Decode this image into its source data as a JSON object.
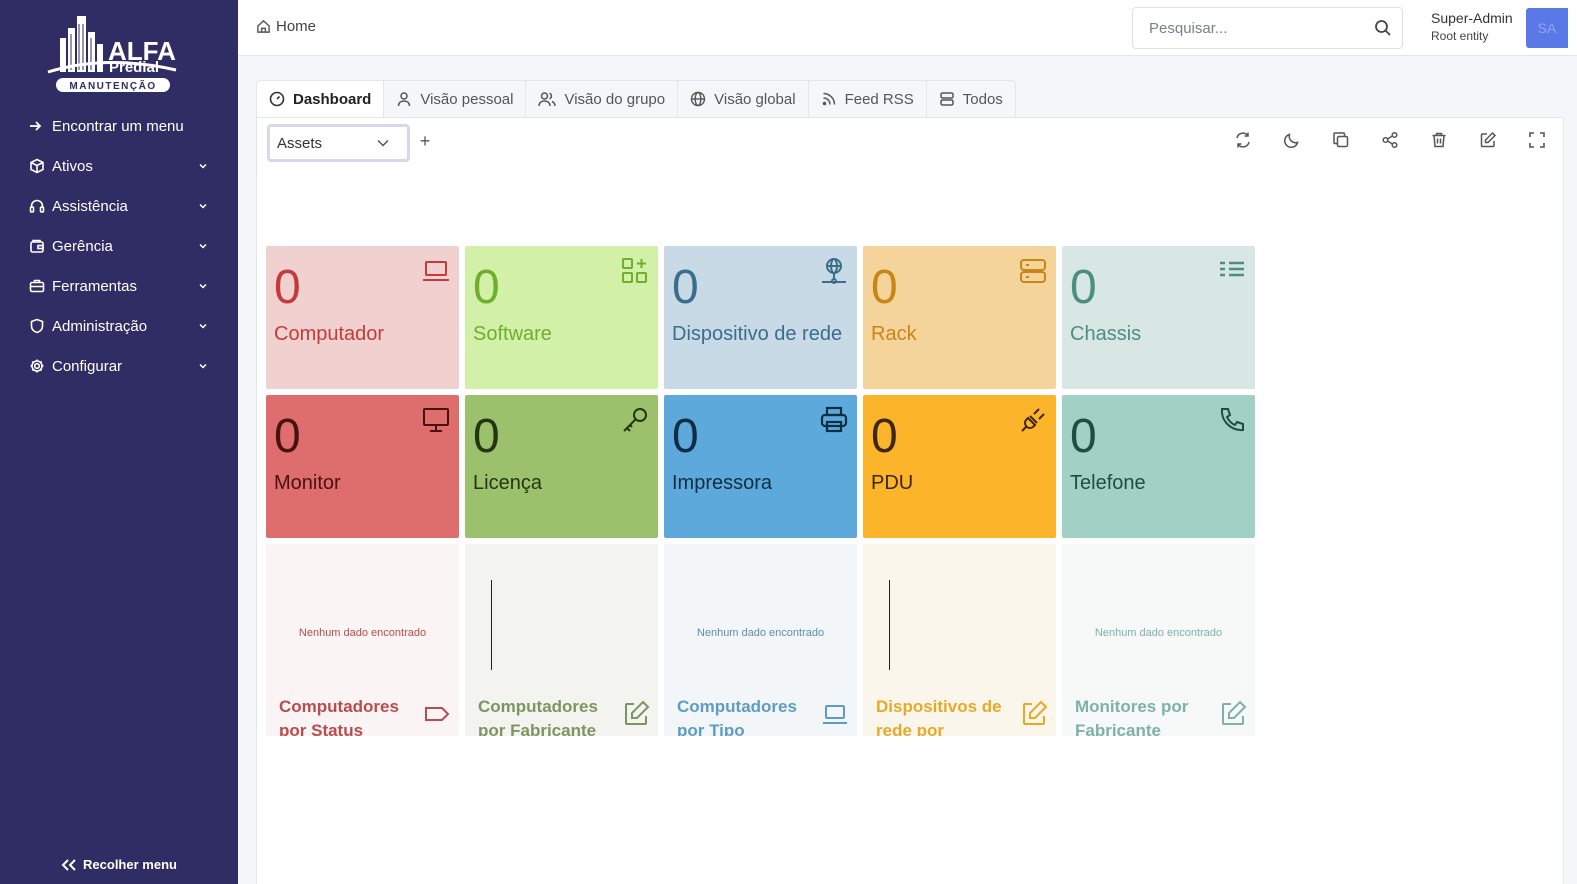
{
  "sidebar": {
    "logo": {
      "word1": "ALFA",
      "word2": "Predial",
      "word3": "MANUTENÇÃO"
    },
    "find_menu": "Encontrar um menu",
    "items": [
      {
        "label": "Ativos",
        "icon": "cube-icon"
      },
      {
        "label": "Assistência",
        "icon": "headset-icon"
      },
      {
        "label": "Gerência",
        "icon": "wallet-icon"
      },
      {
        "label": "Ferramentas",
        "icon": "briefcase-icon"
      },
      {
        "label": "Administração",
        "icon": "shield-icon"
      },
      {
        "label": "Configurar",
        "icon": "gear-icon"
      }
    ],
    "collapse": "Recolher menu"
  },
  "header": {
    "breadcrumb": "Home",
    "search_placeholder": "Pesquisar...",
    "user_name": "Super-Admin",
    "user_entity": "Root entity",
    "avatar_initials": "SA"
  },
  "tabs": [
    {
      "label": "Dashboard",
      "icon": "gauge-icon",
      "active": true
    },
    {
      "label": "Visão pessoal",
      "icon": "user-icon"
    },
    {
      "label": "Visão do grupo",
      "icon": "users-icon"
    },
    {
      "label": "Visão global",
      "icon": "globe-icon"
    },
    {
      "label": "Feed RSS",
      "icon": "rss-icon"
    },
    {
      "label": "Todos",
      "icon": "stack-icon"
    }
  ],
  "dashboard": {
    "selected": "Assets",
    "add": "+"
  },
  "cards": [
    {
      "value": "0",
      "label": "Computador",
      "icon": "laptop-icon",
      "bg": "#f1d0d0",
      "fg": "#c43b3b"
    },
    {
      "value": "0",
      "label": "Software",
      "icon": "apps-add-icon",
      "bg": "#d3f0a9",
      "fg": "#6fae2e"
    },
    {
      "value": "0",
      "label": "Dispositivo de rede",
      "icon": "network-icon",
      "bg": "#c8dae5",
      "fg": "#3b6d8c"
    },
    {
      "value": "0",
      "label": "Rack",
      "icon": "server-icon",
      "bg": "#f5d49c",
      "fg": "#c88617"
    },
    {
      "value": "0",
      "label": "Chassis",
      "icon": "list-icon",
      "bg": "#d8e7e4",
      "fg": "#4c8f82"
    },
    {
      "value": "0",
      "label": "Monitor",
      "icon": "monitor-icon",
      "bg": "#de6d6d",
      "fg": "#4a1111"
    },
    {
      "value": "0",
      "label": "Licença",
      "icon": "key-icon",
      "bg": "#9cc16d",
      "fg": "#243510"
    },
    {
      "value": "0",
      "label": "Impressora",
      "icon": "printer-icon",
      "bg": "#5ea9db",
      "fg": "#0f2d43"
    },
    {
      "value": "0",
      "label": "PDU",
      "icon": "plug-icon",
      "bg": "#fcb42b",
      "fg": "#3d2704"
    },
    {
      "value": "0",
      "label": "Telefone",
      "icon": "phone-icon",
      "bg": "#a1d0c4",
      "fg": "#1f4d43"
    }
  ],
  "charts": [
    {
      "title": "Computadores por Status",
      "nodata": "Nenhum dado encontrado",
      "icon": "tag-icon",
      "bg": "#faf4f4",
      "fg": "#b94d4d",
      "nodata_color": "#b94d4d"
    },
    {
      "title": "Computadores por Fabricante",
      "nodata": "",
      "icon": "edit-icon",
      "bg": "#f3f4ef",
      "fg": "#7d9560",
      "nodata_color": "#7d9560"
    },
    {
      "title": "Computadores por Tipo",
      "nodata": "Nenhum dado encontrado",
      "icon": "laptop-icon",
      "bg": "#f3f6f8",
      "fg": "#5e9cc4",
      "nodata_color": "#5e8fa8"
    },
    {
      "title": "Dispositivos de rede por",
      "nodata": "",
      "icon": "edit-icon",
      "bg": "#fbf6ec",
      "fg": "#e9a928",
      "nodata_color": "#e9a928"
    },
    {
      "title": "Monitores por Fabricante",
      "nodata": "Nenhum dado encontrado",
      "icon": "edit-icon",
      "bg": "#f7f8f8",
      "fg": "#7eb2a7",
      "nodata_color": "#7eb2a7"
    }
  ]
}
